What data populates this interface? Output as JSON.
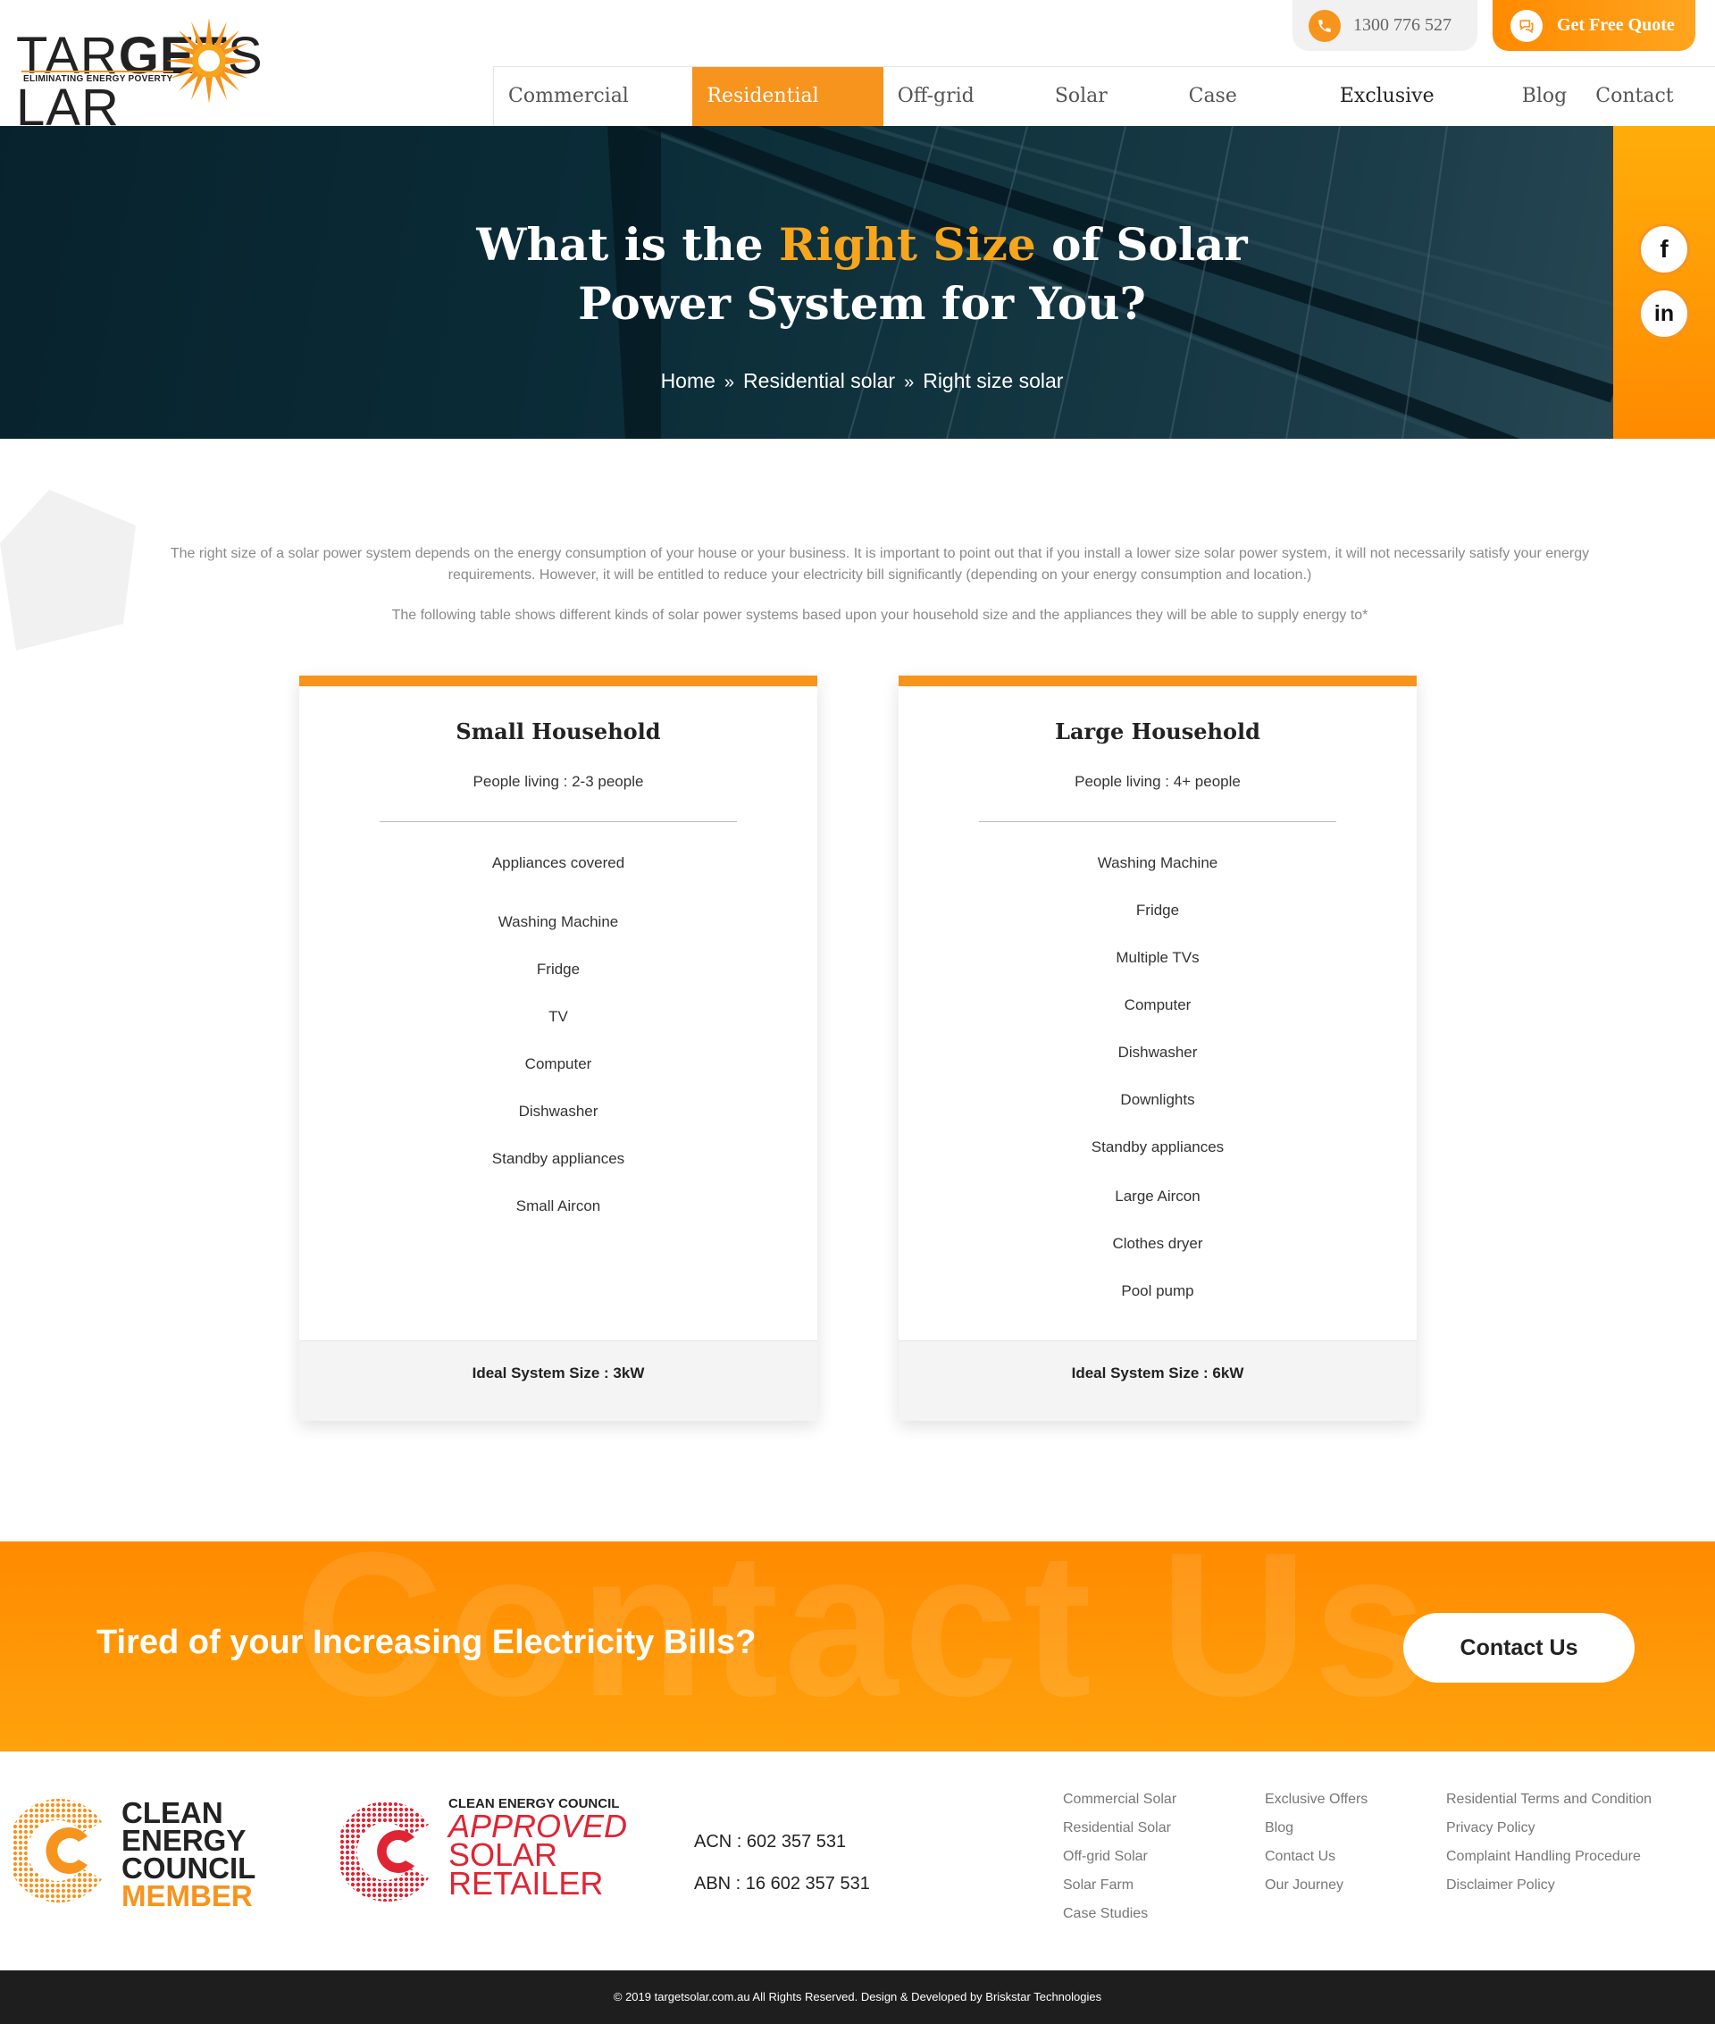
{
  "header": {
    "logo": {
      "brand": "TARGETSOLAR",
      "tagline": "ELIMINATING ENERGY POVERTY"
    },
    "phone": "1300 776 527",
    "quote_button": "Get Free Quote",
    "nav": [
      {
        "label": "Commercial Solar"
      },
      {
        "label": "Residential Solar"
      },
      {
        "label": "Off-grid Solar"
      },
      {
        "label": "Solar Farm"
      },
      {
        "label": "Case Studies"
      },
      {
        "label": "Exclusive Offers"
      },
      {
        "label": "Blog"
      },
      {
        "label": "Contact Us"
      }
    ]
  },
  "hero": {
    "title_part1": "What is the ",
    "title_highlight": "Right Size",
    "title_part2": " of Solar",
    "title_line2": "Power System for You?",
    "breadcrumbs": [
      "Home",
      "Residential solar",
      "Right size solar"
    ],
    "breadcrumb_sep": "»"
  },
  "intro": {
    "paragraph1": "The right size of a solar power system depends on the energy consumption of your house or your business. It is important to point out that if you install a lower size solar power system, it will not necessarily satisfy your energy requirements. However, it will be entitled to reduce your electricity bill significantly (depending on your energy consumption and location.)",
    "paragraph2": "The following table shows different kinds of solar power systems based upon your household size and the appliances they will be able to supply energy to*"
  },
  "cards": [
    {
      "title": "Small Household",
      "people": "People living : 2-3 people",
      "appliances_heading": "Appliances covered",
      "items": [
        "Washing Machine",
        "Fridge",
        "TV",
        "Computer",
        "Dishwasher",
        "Standby appliances",
        "Small Aircon"
      ],
      "footer": "Ideal System Size : 3kW"
    },
    {
      "title": "Large Household",
      "people": "People living : 4+ people",
      "items": [
        "Washing Machine",
        "Fridge",
        "Multiple TVs",
        "Computer",
        "Dishwasher",
        "Downlights",
        "Standby appliances",
        "Large Aircon",
        "Clothes dryer",
        "Pool pump"
      ],
      "footer": "Ideal System Size : 6kW"
    }
  ],
  "cta": {
    "ghost_text": "Contact Us",
    "text": "Tired of your Increasing Electricity Bills?",
    "button": "Contact Us"
  },
  "footer": {
    "badge1": {
      "line1": "CLEAN",
      "line2": "ENERGY",
      "line3": "COUNCIL",
      "line4": "MEMBER"
    },
    "badge2": {
      "line1": "CLEAN ENERGY COUNCIL",
      "line2": "APPROVED",
      "line3": "SOLAR",
      "line4": "RETAILER"
    },
    "acn": "ACN : 602 357 531",
    "abn": "ABN : 16 602 357 531",
    "links_col1": [
      "Commercial Solar",
      "Residential Solar",
      "Off-grid Solar",
      "Solar Farm",
      "Case Studies"
    ],
    "links_col2": [
      "Exclusive Offers",
      "Blog",
      "Contact Us",
      "Our Journey"
    ],
    "links_col3": [
      "Residential Terms and Condition",
      "Privacy Policy",
      "Complaint Handling Procedure",
      "Disclaimer Policy"
    ],
    "copyright": "© 2019 targetsolar.com.au All Rights Reserved. Design & Developed by Briskstar Technologies"
  },
  "social": {
    "facebook": "f",
    "linkedin": "in"
  },
  "colors": {
    "accent": "#f7941d",
    "hero_highlight": "#f7a51c",
    "dark_footer": "#1e1e1e"
  }
}
